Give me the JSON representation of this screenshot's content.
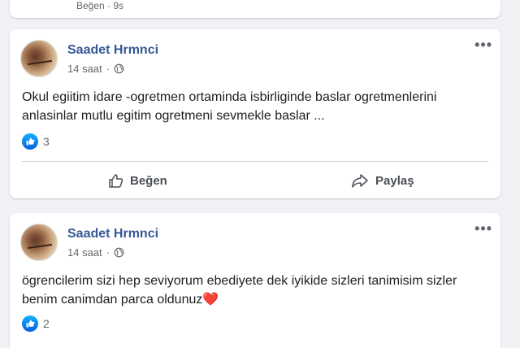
{
  "top_card": {
    "like_label": "Beğen",
    "time": "9s"
  },
  "posts": [
    {
      "author": "Saadet Hrmnci",
      "time": "14 saat",
      "text": "Okul egiitim idare -ogretmen ortaminda isbirliginde baslar ogretmenlerini anlasinlar mutlu egitim ogretmeni sevmekle baslar ...",
      "reaction_count": "3",
      "like_label": "Beğen",
      "share_label": "Paylaş"
    },
    {
      "author": "Saadet Hrmnci",
      "time": "14 saat",
      "text": "ögrencilerim sizi hep seviyorum ebediyete dek iyikide sizleri tanimisim sizler benim canimdan parca oldunuz",
      "text_suffix": "❤️",
      "reaction_count": "2"
    }
  ],
  "colors": {
    "author": "#385898",
    "like_blue": "#1877f2",
    "background": "#f0f2f5"
  },
  "icons": [
    "globe-icon",
    "more-options-icon",
    "like-reaction-icon",
    "thumb-up-icon",
    "share-icon"
  ]
}
